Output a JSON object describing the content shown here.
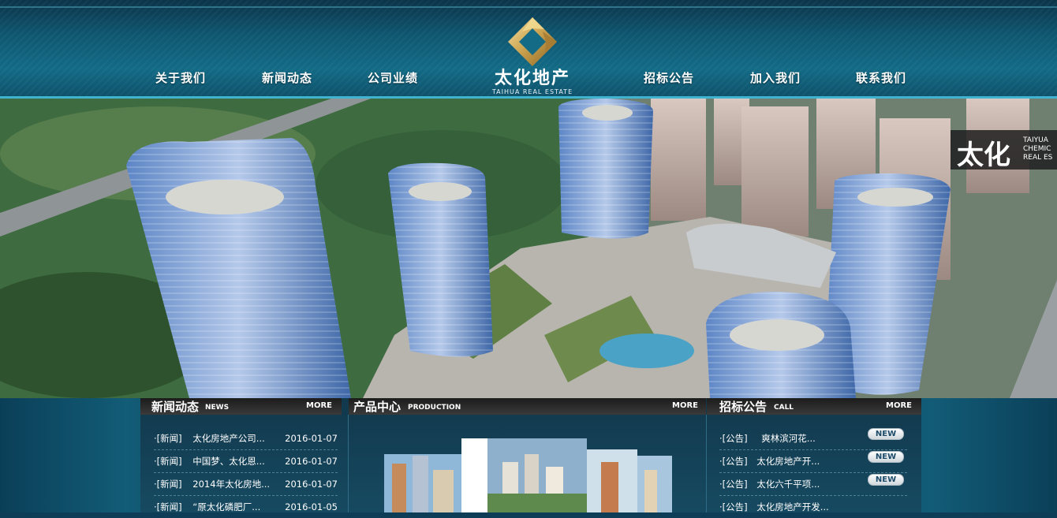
{
  "nav": {
    "left": [
      "关于我们",
      "新闻动态",
      "公司业绩"
    ],
    "right": [
      "招标公告",
      "加入我们",
      "联系我们"
    ]
  },
  "logo": {
    "name_cn": "太化地产",
    "name_en": "TAIHUA REAL ESTATE"
  },
  "hero": {
    "sign_big": "太化",
    "sign_lines": [
      "TAIYUA",
      "CHEMIC",
      "REAL ES"
    ]
  },
  "news": {
    "title_cn": "新闻动态",
    "title_en": "NEWS",
    "more": "MORE",
    "items": [
      {
        "tag": "·[新闻]",
        "title": "太化房地产公司...",
        "date": "2016-01-07"
      },
      {
        "tag": "·[新闻]",
        "title": "中国梦、太化恩...",
        "date": "2016-01-07"
      },
      {
        "tag": "·[新闻]",
        "title": "2014年太化房地...",
        "date": "2016-01-07"
      },
      {
        "tag": "·[新闻]",
        "title": "“原太化磷肥厂...",
        "date": "2016-01-05"
      }
    ]
  },
  "products": {
    "title_cn": "产品中心",
    "title_en": "PRODUCTION",
    "more": "MORE"
  },
  "tenders": {
    "title_cn": "招标公告",
    "title_en": "CALL",
    "more": "MORE",
    "new_label": "NEW",
    "items": [
      {
        "tag": "·[公告]",
        "title": "爽林滨河花..."
      },
      {
        "tag": "·[公告]",
        "title": "太化房地产开..."
      },
      {
        "tag": "·[公告]",
        "title": "太化六千平项..."
      },
      {
        "tag": "·[公告]",
        "title": "太化房地产开发..."
      }
    ]
  }
}
